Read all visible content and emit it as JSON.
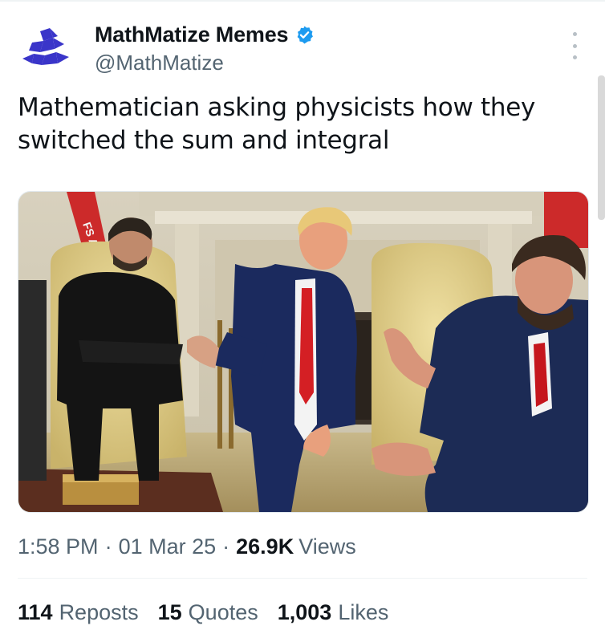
{
  "author": {
    "display_name": "MathMatize Memes",
    "handle": "@MathMatize",
    "verified": true,
    "avatar_icon": "mathmatize-logo-icon",
    "verified_icon": "verified-badge-icon",
    "brand_color": "#3a35c9",
    "verified_color": "#1d9bf0"
  },
  "tweet": {
    "text": "Mathematician asking physicists how they switched the sum and integral",
    "media_description": "photo-of-four-men-in-oval-office-meeting"
  },
  "meta": {
    "time": "1:58 PM",
    "date": "01 Mar 25",
    "views_count": "26.9K",
    "views_label": "Views"
  },
  "stats": {
    "reposts_count": "114",
    "reposts_label": "Reposts",
    "quotes_count": "15",
    "quotes_label": "Quotes",
    "likes_count": "1,003",
    "likes_label": "Likes"
  }
}
